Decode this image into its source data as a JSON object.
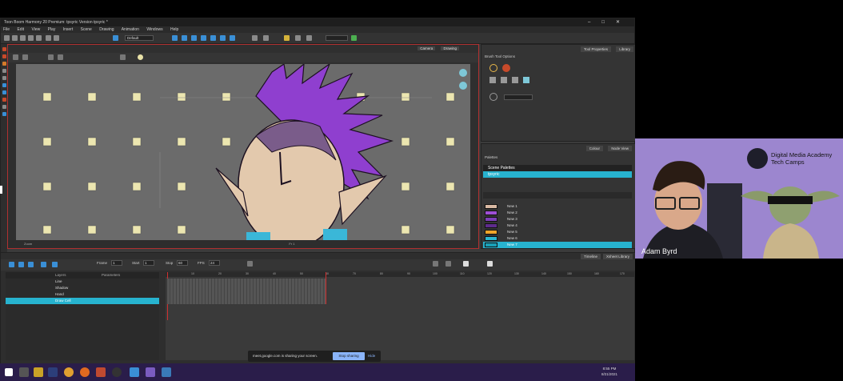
{
  "app": {
    "title": "Toon Boom Harmony 20 Premium: tpsyric Version tpsyric *",
    "menu": [
      "File",
      "Edit",
      "View",
      "Play",
      "Insert",
      "Scene",
      "Drawing",
      "Animation",
      "Windows",
      "Help"
    ],
    "default_label": "Default"
  },
  "camera_view": {
    "tabs": [
      "Camera",
      "Drawing"
    ],
    "status": [
      "Zoom",
      "Fr 1"
    ]
  },
  "tool_properties": {
    "tabs": [
      "Tool Properties",
      "Library"
    ],
    "header": "Brush Tool Options"
  },
  "colour_panel": {
    "tabs": [
      "Colour",
      "Node View"
    ],
    "palettes_label": "Palettes",
    "scene_palettes_label": "Scene Palettes",
    "scene_palette_item": "tpsyric",
    "colours": [
      {
        "name": "New 1",
        "hex": "#d8b9a3"
      },
      {
        "name": "New 2",
        "hex": "#9e4fd6"
      },
      {
        "name": "New 3",
        "hex": "#7d3fb8"
      },
      {
        "name": "New 4",
        "hex": "#5e2c8c"
      },
      {
        "name": "New 5",
        "hex": "#f0a52a"
      },
      {
        "name": "New 6",
        "hex": "#2bb7d1"
      },
      {
        "name": "New 7",
        "hex": "#1aa0b7"
      }
    ]
  },
  "timeline": {
    "tabs": [
      "Timeline",
      "Xsheet Library"
    ],
    "frame_label": "Frame",
    "frame_value": "1",
    "start_label": "Start",
    "start_value": "1",
    "stop_label": "Stop",
    "stop_value": "60",
    "fps_label": "FPS",
    "fps_value": "24",
    "layers_header": [
      "Layers",
      "Parameters"
    ],
    "layers": [
      "Line",
      "Shadow",
      "Hand",
      "Draw Cell"
    ],
    "ruler": [
      "10",
      "20",
      "30",
      "40",
      "50",
      "60",
      "70",
      "80",
      "90",
      "100",
      "110",
      "120",
      "130",
      "140",
      "150",
      "160",
      "170"
    ]
  },
  "share_bar": {
    "message": "meet.google.com is sharing your screen.",
    "stop_button": "Stop sharing",
    "hide_button": "Hide"
  },
  "taskbar": {
    "time": "8:55 PM",
    "date": "8/21/2021"
  },
  "webcam": {
    "presenter_name": "Adam Byrd",
    "brand_line1": "Digital Media Academy",
    "brand_line2": "Tech Camps"
  },
  "colors": {
    "app_bg": "#3b3b3b",
    "accent_red": "#b03030",
    "taskbar": "#2a1d4a",
    "highlight": "#27b3cf",
    "webcam_bg": "#9c86cf"
  }
}
